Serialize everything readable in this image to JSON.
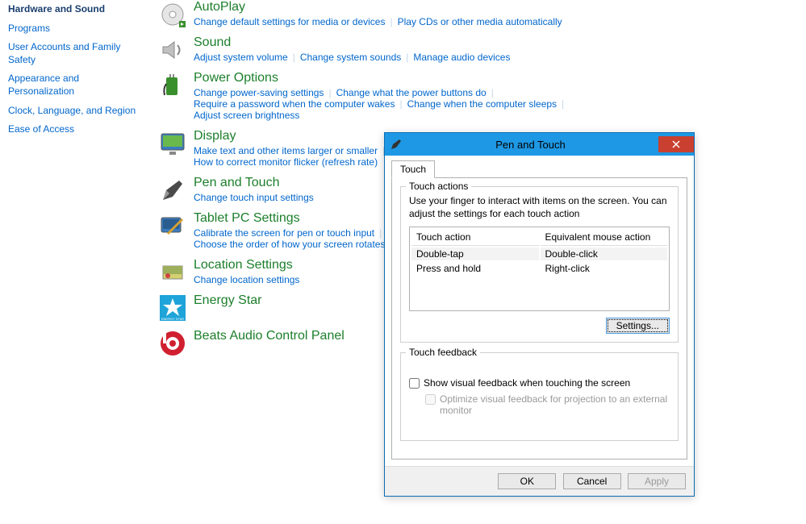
{
  "sidebar": {
    "items": [
      {
        "label": "Hardware and Sound",
        "current": true
      },
      {
        "label": "Programs"
      },
      {
        "label": "User Accounts and Family Safety"
      },
      {
        "label": "Appearance and Personalization"
      },
      {
        "label": "Clock, Language, and Region"
      },
      {
        "label": "Ease of Access"
      }
    ]
  },
  "categories": [
    {
      "title": "AutoPlay",
      "links": [
        "Change default settings for media or devices",
        "Play CDs or other media automatically"
      ]
    },
    {
      "title": "Sound",
      "links": [
        "Adjust system volume",
        "Change system sounds",
        "Manage audio devices"
      ]
    },
    {
      "title": "Power Options",
      "links": [
        "Change power-saving settings",
        "Change what the power buttons do",
        "Require a password when the computer wakes",
        "Change when the computer sleeps",
        "Adjust screen brightness"
      ]
    },
    {
      "title": "Display",
      "links": [
        "Make text and other items larger or smaller",
        "How to correct monitor flicker (refresh rate)"
      ]
    },
    {
      "title": "Pen and Touch",
      "links": [
        "Change touch input settings"
      ]
    },
    {
      "title": "Tablet PC Settings",
      "links": [
        "Calibrate the screen for pen or touch input",
        "Choose the order of how your screen rotates"
      ]
    },
    {
      "title": "Location Settings",
      "links": [
        "Change location settings"
      ]
    },
    {
      "title": "Energy Star",
      "links": []
    },
    {
      "title": "Beats Audio Control Panel",
      "links": []
    }
  ],
  "dialog": {
    "title": "Pen and Touch",
    "tab": "Touch",
    "group1": {
      "legend": "Touch actions",
      "desc": "Use your finger to interact with items on the screen. You can adjust the settings for each touch action",
      "col1": "Touch action",
      "col2": "Equivalent mouse action",
      "rows": [
        {
          "a": "Double-tap",
          "b": "Double-click"
        },
        {
          "a": "Press and hold",
          "b": "Right-click"
        }
      ],
      "settings_btn": "Settings..."
    },
    "group2": {
      "legend": "Touch feedback",
      "chk1": "Show visual feedback when touching the screen",
      "chk2": "Optimize visual feedback for projection to an external monitor"
    },
    "buttons": {
      "ok": "OK",
      "cancel": "Cancel",
      "apply": "Apply"
    }
  }
}
